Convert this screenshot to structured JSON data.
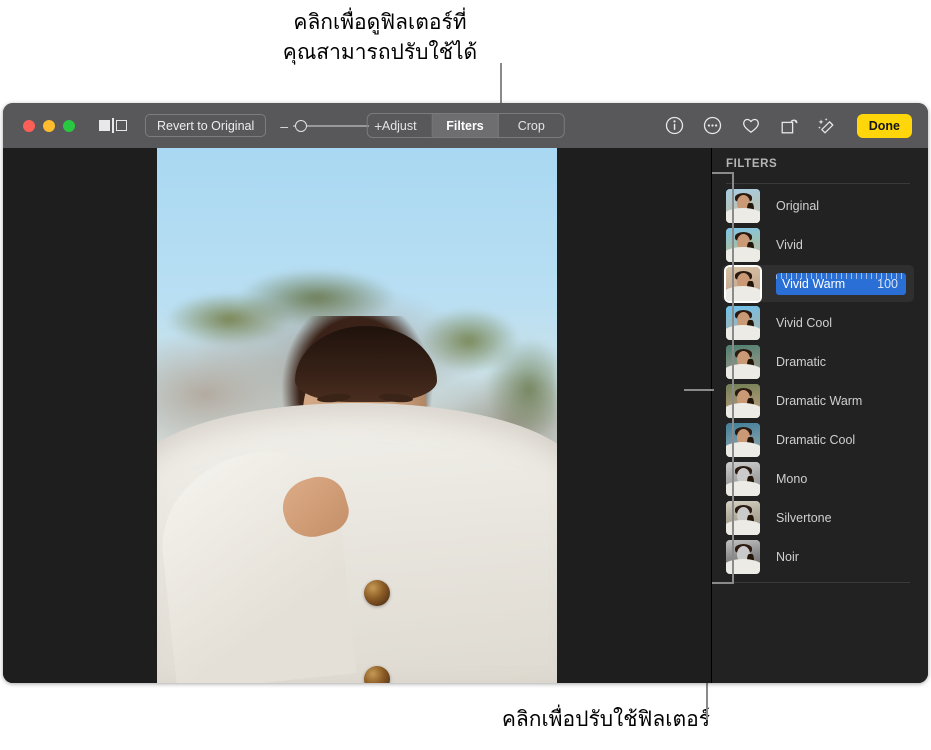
{
  "callouts": {
    "top": "คลิกเพื่อดูฟิลเตอร์ที่\nคุณสามารถปรับใช้ได้",
    "bottom": "คลิกเพื่อปรับใช้ฟิลเตอร์"
  },
  "toolbar": {
    "compare_icon": "split-compare-icon",
    "revert_label": "Revert to Original",
    "zoom_minus": "–",
    "zoom_plus": "+",
    "segments": [
      {
        "label": "Adjust",
        "active": false
      },
      {
        "label": "Filters",
        "active": true
      },
      {
        "label": "Crop",
        "active": false
      }
    ],
    "icons": [
      "info-icon",
      "more-icon",
      "favorite-icon",
      "rotate-icon",
      "auto-enhance-icon"
    ],
    "done_label": "Done",
    "done_color": "#ffd60a"
  },
  "panel": {
    "header": "FILTERS",
    "selected_color": "#2a6fd6",
    "filters": [
      {
        "label": "Original",
        "selected": false
      },
      {
        "label": "Vivid",
        "selected": false
      },
      {
        "label": "Vivid Warm",
        "selected": true,
        "value": "100"
      },
      {
        "label": "Vivid Cool",
        "selected": false
      },
      {
        "label": "Dramatic",
        "selected": false
      },
      {
        "label": "Dramatic Warm",
        "selected": false
      },
      {
        "label": "Dramatic Cool",
        "selected": false
      },
      {
        "label": "Mono",
        "selected": false
      },
      {
        "label": "Silvertone",
        "selected": false
      },
      {
        "label": "Noir",
        "selected": false
      }
    ]
  }
}
